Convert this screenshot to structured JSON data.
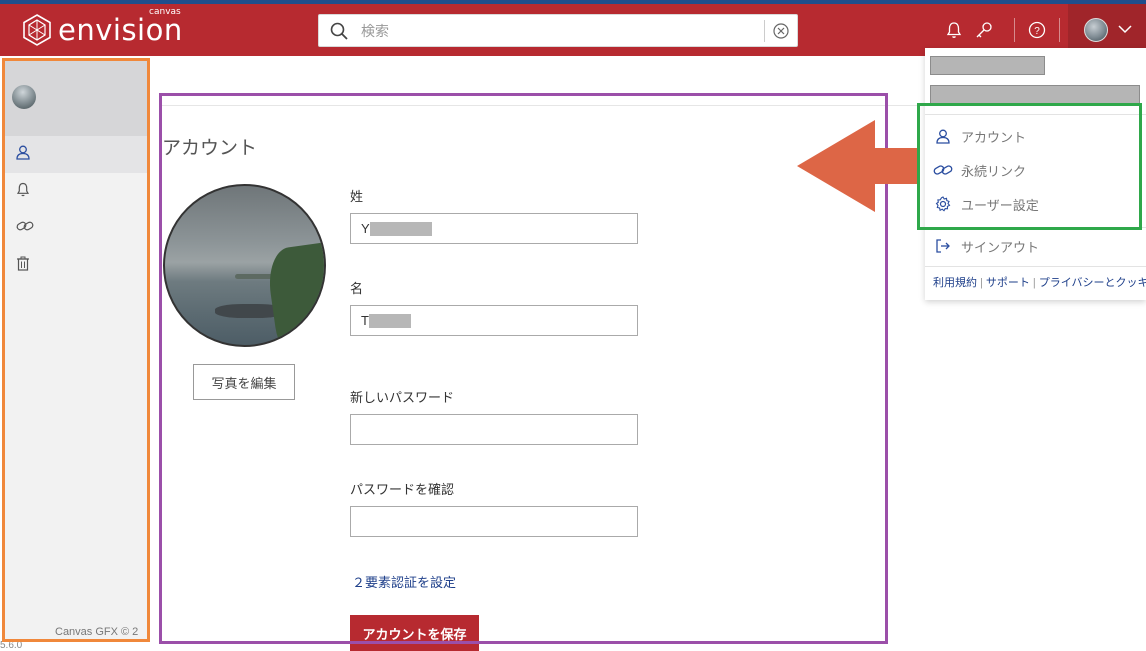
{
  "header": {
    "brand": "envision",
    "brand_small": "canvas",
    "search_placeholder": "検索"
  },
  "sidebar": {
    "items": [
      {
        "icon": "user-icon",
        "active": true
      },
      {
        "icon": "bell-icon",
        "active": false
      },
      {
        "icon": "link-icon",
        "active": false
      },
      {
        "icon": "trash-icon",
        "active": false
      }
    ],
    "footer": "Canvas GFX © 2",
    "version": "5.6.0"
  },
  "account": {
    "title": "アカウント",
    "edit_photo": "写真を編集",
    "last_name_label": "姓",
    "last_name_value": "Y",
    "first_name_label": "名",
    "first_name_value": "T",
    "new_password_label": "新しいパスワード",
    "confirm_password_label": "パスワードを確認",
    "two_factor_link": "２要素認証を設定",
    "save_button": "アカウントを保存"
  },
  "dropdown": {
    "items": [
      {
        "label": "アカウント",
        "icon": "user-icon"
      },
      {
        "label": "永続リンク",
        "icon": "link-icon"
      },
      {
        "label": "ユーザー設定",
        "icon": "gear-icon"
      }
    ],
    "signout": "サインアウト",
    "footer_links": [
      "利用規約",
      "サポート",
      "プライバシーとクッキー"
    ]
  },
  "colors": {
    "header": "#b72a30",
    "link": "#1e3f8a",
    "annotation_orange": "#f0883b",
    "annotation_purple": "#9b4fa9",
    "annotation_green": "#2fa84a",
    "arrow": "#dd6646"
  }
}
